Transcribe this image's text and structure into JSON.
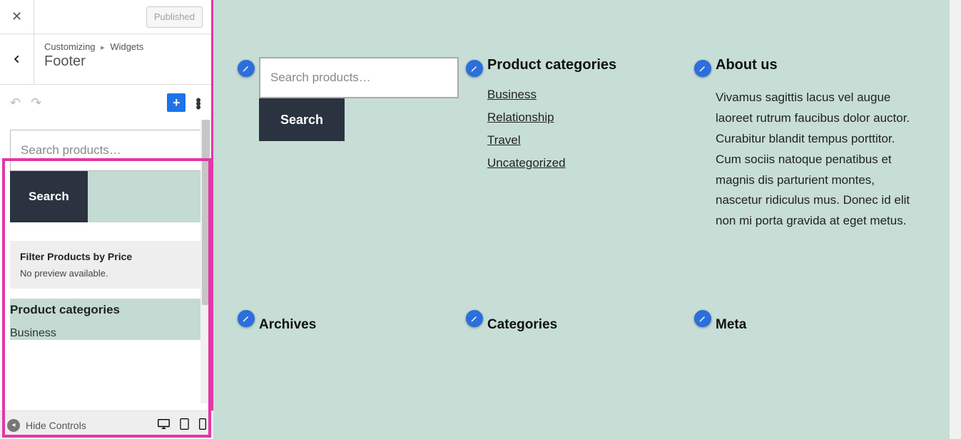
{
  "header": {
    "published_label": "Published",
    "crumb_root": "Customizing",
    "crumb_leaf": "Widgets",
    "title": "Footer",
    "hide_controls": "Hide Controls"
  },
  "editor": {
    "search": {
      "placeholder": "Search products…",
      "button": "Search"
    },
    "filter": {
      "title": "Filter Products by Price",
      "subtitle": "No preview available."
    },
    "categories": {
      "heading": "Product categories",
      "first": "Business"
    }
  },
  "preview": {
    "search": {
      "placeholder": "Search products…",
      "button": "Search"
    },
    "product_categories": {
      "heading": "Product categories",
      "items": [
        "Business",
        "Relationship",
        "Travel",
        "Uncategorized"
      ]
    },
    "about": {
      "heading": "About us",
      "body": "Vivamus sagittis lacus vel augue laoreet rutrum faucibus dolor auctor. Curabitur blandit tempus porttitor. Cum sociis natoque penatibus et magnis dis parturient montes, nascetur ridiculus mus. Donec id elit non mi porta gravida at eget metus."
    },
    "row2": {
      "a": "Archives",
      "b": "Categories",
      "c": "Meta"
    }
  },
  "icons": {
    "pencil": "pencil-icon"
  }
}
